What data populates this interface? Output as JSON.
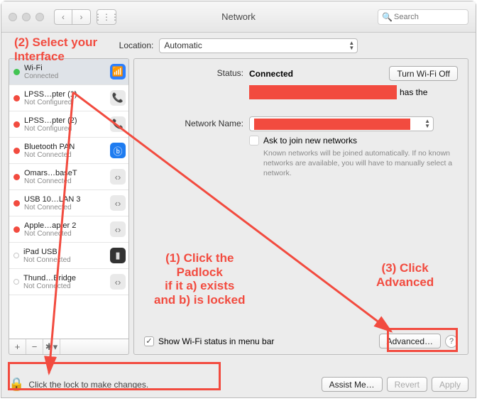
{
  "window": {
    "title": "Network"
  },
  "search": {
    "placeholder": "Search"
  },
  "location": {
    "label": "Location:",
    "value": "Automatic"
  },
  "sidebar": {
    "items": [
      {
        "name": "Wi-Fi",
        "status": "Connected",
        "dot": "green",
        "icon": "wifi",
        "selected": true
      },
      {
        "name": "LPSS…pter (1)",
        "status": "Not Configured",
        "dot": "red",
        "icon": "phone"
      },
      {
        "name": "LPSS…pter (2)",
        "status": "Not Configured",
        "dot": "red",
        "icon": "phone"
      },
      {
        "name": "Bluetooth PAN",
        "status": "Not Connected",
        "dot": "red",
        "icon": "bt"
      },
      {
        "name": "Omars…baseT",
        "status": "Not Connected",
        "dot": "red",
        "icon": "eth"
      },
      {
        "name": "USB 10…LAN 3",
        "status": "Not Connected",
        "dot": "red",
        "icon": "eth"
      },
      {
        "name": "Apple…apter 2",
        "status": "Not Connected",
        "dot": "red",
        "icon": "eth"
      },
      {
        "name": "iPad USB",
        "status": "Not Connected",
        "dot": "hollow",
        "icon": "ipad"
      },
      {
        "name": "Thund…Bridge",
        "status": "Not Connected",
        "dot": "hollow",
        "icon": "eth"
      }
    ]
  },
  "detail": {
    "status_label": "Status:",
    "status_value": "Connected",
    "wifi_off_btn": "Turn Wi-Fi Off",
    "has_the_text": "has the",
    "network_name_label": "Network Name:",
    "ask_join_label": "Ask to join new networks",
    "ask_join_help": "Known networks will be joined automatically. If no known networks are available, you will have to manually select a network.",
    "show_menu_label": "Show Wi-Fi status in menu bar",
    "advanced_btn": "Advanced…"
  },
  "footer": {
    "lock_text": "Click the lock to make changes.",
    "assist_btn": "Assist Me…",
    "revert_btn": "Revert",
    "apply_btn": "Apply"
  },
  "annotations": {
    "a2": "(2) Select your\nInterface",
    "a1": "(1) Click the\nPadlock\nif it a) exists\nand b) is locked",
    "a3": "(3) Click\nAdvanced"
  },
  "colors": {
    "accent": "#f24b3f"
  }
}
